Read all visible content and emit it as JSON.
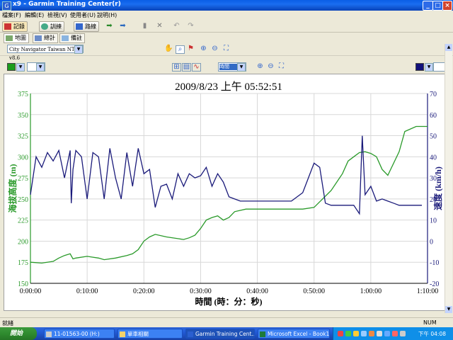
{
  "window": {
    "title": "x9 - Garmin Training Center(r)"
  },
  "menu": [
    "檔案(F)",
    "編輯(E)",
    "檢視(V)",
    "使用者(U)",
    "說明(H)"
  ],
  "toolbar": {
    "history": "記錄",
    "training": "訓練",
    "courses": "路線"
  },
  "tabs": {
    "map": "地圖",
    "stats": "總計",
    "notes": "備註"
  },
  "map": {
    "product": "City Navigator Taiwan NT v8.6"
  },
  "chart_toolbar": {
    "x_axis_select": "時間"
  },
  "colors": {
    "elevation": "#2a9a2a",
    "speed": "#1a1a7a",
    "left_axis": "#2a9a2a",
    "right_axis": "#1a1a7a"
  },
  "chart_data": {
    "type": "line",
    "title": "2009/8/23 上午 05:52:51",
    "xlabel": "時間 (時：分：秒)",
    "ylabel_left": "海拔高度 (m)",
    "ylabel_right": "速度 (km/h)",
    "x_range_min": [
      0,
      70
    ],
    "x_ticks": [
      "0:00:00",
      "0:10:00",
      "0:20:00",
      "0:30:00",
      "0:40:00",
      "0:50:00",
      "1:00:00",
      "1:10:00"
    ],
    "y_left": {
      "range": [
        150,
        375
      ],
      "ticks": [
        150,
        175,
        200,
        225,
        250,
        275,
        300,
        325,
        350,
        375
      ]
    },
    "y_right": {
      "range": [
        -20,
        70
      ],
      "ticks": [
        -20,
        -10,
        0,
        10,
        20,
        30,
        40,
        50,
        60,
        70
      ]
    },
    "grid": true,
    "series": [
      {
        "axis": "left",
        "x_min": [
          0,
          2,
          4,
          5,
          6,
          7,
          7.5,
          8,
          10,
          12,
          13,
          15,
          17,
          18,
          19,
          20,
          21,
          22,
          24,
          26,
          27,
          28,
          29,
          30,
          31,
          32,
          33,
          34,
          35,
          36,
          38,
          40,
          42,
          45,
          47,
          48,
          50,
          53,
          55,
          56,
          57,
          58,
          59,
          60,
          61,
          62,
          63,
          65,
          66,
          68,
          70
        ],
        "values": [
          175,
          174,
          176,
          180,
          183,
          185,
          179,
          180,
          182,
          180,
          178,
          180,
          183,
          185,
          190,
          200,
          205,
          208,
          205,
          203,
          202,
          204,
          207,
          215,
          225,
          228,
          230,
          225,
          228,
          235,
          238,
          238,
          238,
          238,
          238,
          238,
          240,
          260,
          280,
          295,
          300,
          305,
          306,
          304,
          300,
          285,
          278,
          306,
          330,
          336,
          336
        ]
      },
      {
        "axis": "right",
        "x_min": [
          0,
          1,
          2,
          3,
          4,
          5,
          6,
          7,
          7.2,
          7.5,
          8,
          9,
          10,
          11,
          12,
          13,
          14,
          15,
          16,
          17,
          18,
          19,
          20,
          21,
          22,
          23,
          24,
          25,
          26,
          27,
          28,
          29,
          30,
          31,
          32,
          33,
          34,
          35,
          36,
          37,
          38,
          40,
          42,
          44,
          46,
          48,
          50,
          51,
          52,
          53,
          54,
          55,
          56,
          57,
          58,
          58.5,
          59,
          60,
          61,
          62,
          63,
          64,
          65,
          66,
          67,
          68,
          69
        ],
        "values": [
          22,
          40,
          35,
          42,
          38,
          43,
          30,
          43,
          18,
          34,
          43,
          40,
          20,
          42,
          40,
          20,
          44,
          30,
          20,
          42,
          26,
          44,
          32,
          34,
          16,
          26,
          27,
          20,
          32,
          26,
          32,
          30,
          31,
          35,
          26,
          32,
          28,
          21,
          20,
          19,
          19,
          19,
          19,
          19,
          19,
          23,
          37,
          35,
          18,
          17,
          17,
          17,
          17,
          17,
          13,
          50,
          22,
          26,
          19,
          20,
          19,
          18,
          17,
          17,
          17,
          17,
          17
        ]
      }
    ]
  },
  "status": {
    "text": "就緒",
    "num": "NUM"
  },
  "taskbar": {
    "start": "開始",
    "tasks": [
      "11-01563-00 (H:)",
      "單車相關",
      "Garmin Training Cent...",
      "Microsoft Excel - Book1"
    ],
    "clock": "下午 04:08"
  }
}
